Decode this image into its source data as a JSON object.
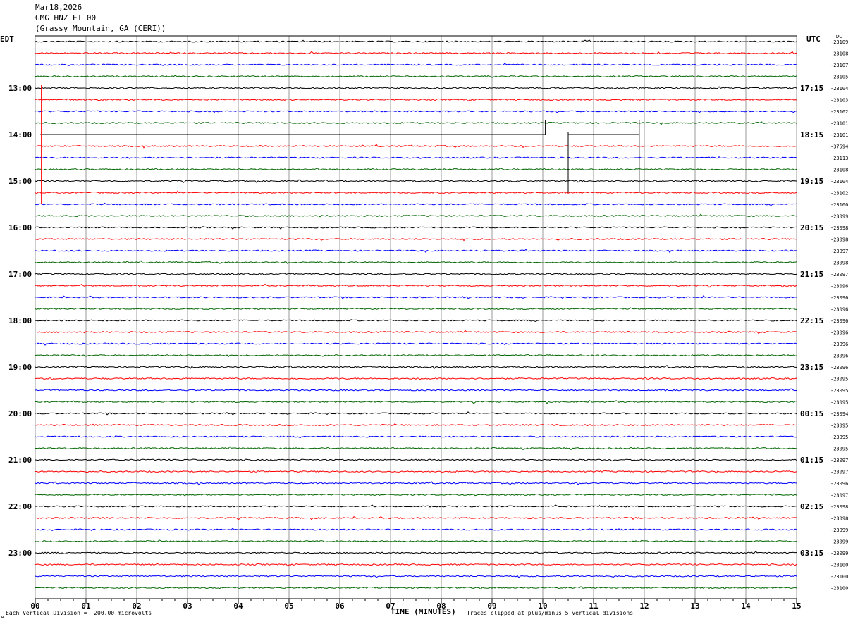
{
  "header": {
    "date": "Mar18,2026",
    "station": "GMG HNZ ET 00",
    "location": "(Grassy Mountain, GA (CERI))"
  },
  "timezones": {
    "left": "EDT",
    "right": "UTC"
  },
  "dc_label": "DC",
  "footer": {
    "scale_note": "Each Vertical Division =  200.00 microvolts",
    "clip_note": "Traces clipped at plus/minus 5 vertical divisions",
    "corner_mark": "ʀ"
  },
  "colors": {
    "trace_cycle": [
      "#000000",
      "#ff0000",
      "#0000ff",
      "#006600"
    ],
    "grid": "#999999",
    "axis": "#000000"
  },
  "chart_data": {
    "type": "line",
    "subtype": "helicorder",
    "xlabel": "TIME (MINUTES)",
    "x_ticks": [
      "00",
      "01",
      "02",
      "03",
      "04",
      "05",
      "06",
      "07",
      "08",
      "09",
      "10",
      "11",
      "12",
      "13",
      "14",
      "15"
    ],
    "xlim": [
      0,
      15
    ],
    "minor_ticks_per_minute": 4,
    "rows_per_hour": 4,
    "minutes_per_row": 15,
    "left_hour_labels": [
      "13:00",
      "14:00",
      "15:00",
      "16:00",
      "17:00",
      "18:00",
      "19:00",
      "20:00",
      "21:00",
      "22:00",
      "23:00"
    ],
    "right_hour_labels": [
      "17:15",
      "18:15",
      "19:15",
      "20:15",
      "21:15",
      "22:15",
      "23:15",
      "00:15",
      "01:15",
      "02:15",
      "03:15"
    ],
    "dc_values": [
      "-23109",
      "-23108",
      "-23107",
      "-23105",
      "-23104",
      "-23103",
      "-23102",
      "-23101",
      "-23101",
      "-37594",
      "-23113",
      "-23108",
      "-23104",
      "-23102",
      "-23100",
      "-23099",
      "-23098",
      "-23098",
      "-23097",
      "-23098",
      "-23097",
      "-23096",
      "-23096",
      "-23096",
      "-23096",
      "-23096",
      "-23096",
      "-23096",
      "-23096",
      "-23095",
      "-23095",
      "-23095",
      "-23094",
      "-23095",
      "-23095",
      "-23095",
      "-23097",
      "-23097",
      "-23096",
      "-23097",
      "-23098",
      "-23098",
      "-23099",
      "-23099",
      "-23099",
      "-23100",
      "-23100",
      "-23100"
    ],
    "offline_rows": [
      8
    ],
    "spike_events": [
      {
        "row": 4,
        "minute": 0.12,
        "y_range_rows": [
          4,
          14
        ],
        "color_index": 1
      },
      {
        "row": 8,
        "minute": 10.05,
        "y_range_rows": [
          7,
          8
        ],
        "color_index": 0
      },
      {
        "row": 8,
        "minute": 10.5,
        "y_range_rows": [
          8,
          13
        ],
        "color_index": 0
      },
      {
        "row": 8,
        "minute": 11.9,
        "y_range_rows": [
          7,
          13
        ],
        "color_index": 0
      }
    ]
  }
}
